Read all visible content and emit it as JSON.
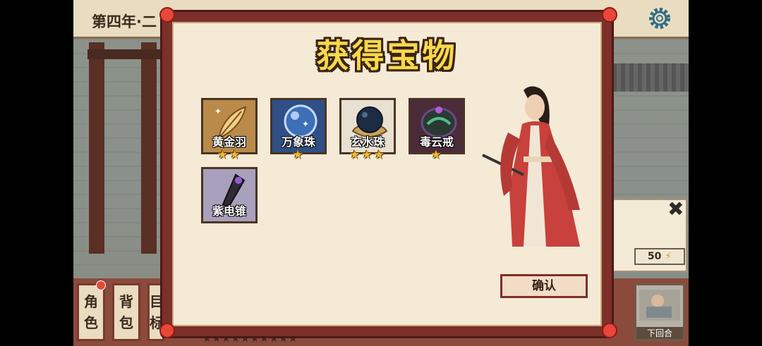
{
  "hud": {
    "date_label": "第四年·二",
    "side_buttons": [
      {
        "line1": "角",
        "line2": "色"
      },
      {
        "line1": "背",
        "line2": "包"
      },
      {
        "line1": "目",
        "line2": "标"
      }
    ],
    "energy_value": "50",
    "next_turn_label": "下回合",
    "stars_bottom": "★★★★★★★★★★"
  },
  "dialog": {
    "title": "获得宝物",
    "items": [
      {
        "name": "黄金羽",
        "stars": "★★",
        "bg": "#b98a4a",
        "icon": "golden-feather-icon"
      },
      {
        "name": "万象珠",
        "stars": "★",
        "bg": "#2f4f86",
        "icon": "crystal-orb-icon"
      },
      {
        "name": "玄水珠",
        "stars": "★★★",
        "bg": "#e8e0d0",
        "icon": "dark-water-orb-icon"
      },
      {
        "name": "毒云戒",
        "stars": "★",
        "bg": "#4b2a3a",
        "icon": "poison-ring-icon"
      },
      {
        "name": "紫电锥",
        "stars": "",
        "bg": "#a8a0bc",
        "icon": "purple-lightning-awl-icon"
      }
    ],
    "confirm_label": "确认"
  }
}
